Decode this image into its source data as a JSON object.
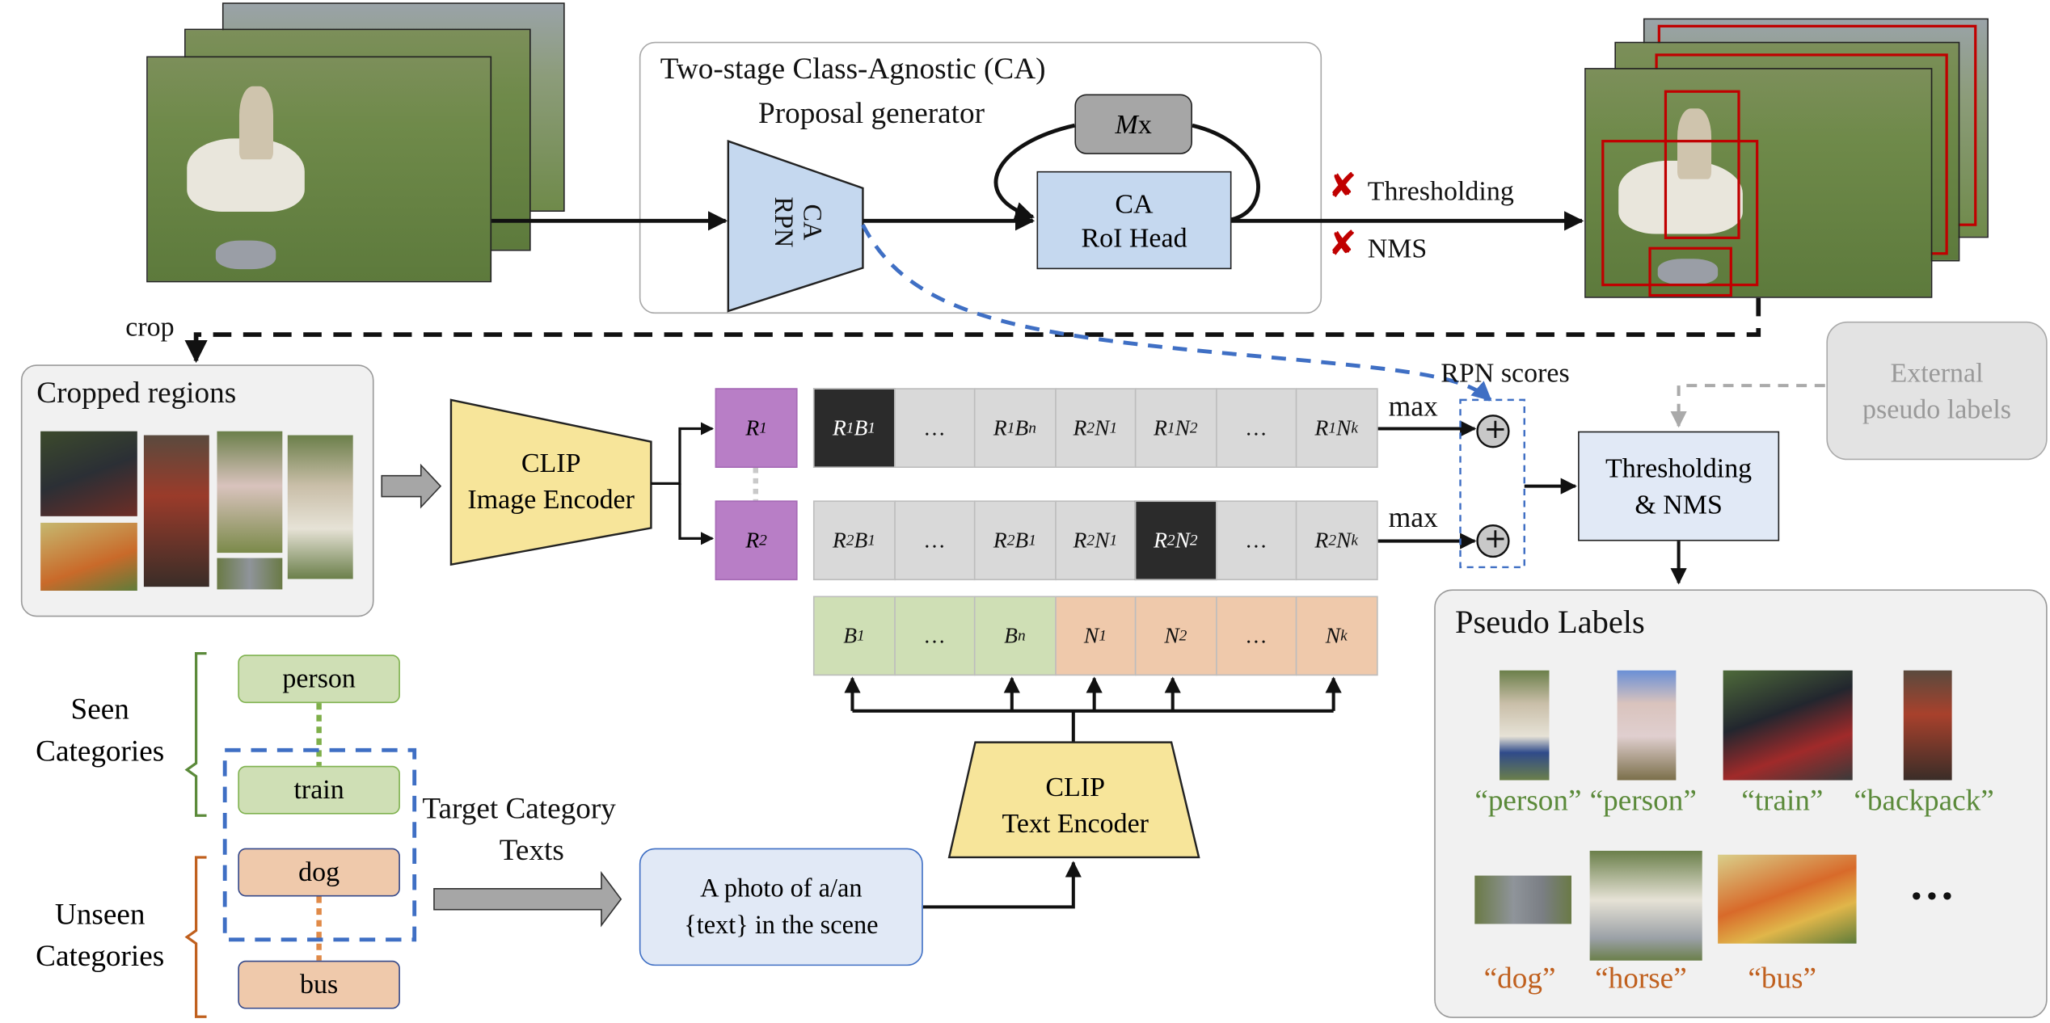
{
  "proposal_generator": {
    "title_line1": "Two-stage Class-Agnostic (CA)",
    "title_line2": "Proposal generator",
    "rpn_line1": "CA",
    "rpn_line2": "RPN",
    "roi_line1": "CA",
    "roi_line2": "RoI Head",
    "repeat_label_italic": "M",
    "repeat_label_suffix": "x"
  },
  "post_process": {
    "disabled_items": [
      {
        "label": "Thresholding",
        "icon": "x-mark-icon"
      },
      {
        "label": "NMS",
        "icon": "x-mark-icon"
      }
    ],
    "x_color": "#c00000"
  },
  "crop_label": "crop",
  "cropped_regions": {
    "title": "Cropped regions"
  },
  "clip_image_encoder": {
    "line1": "CLIP",
    "line2": "Image Encoder"
  },
  "region_features": [
    {
      "base": "R",
      "sub": "1"
    },
    {
      "base": "R",
      "sub": "2"
    }
  ],
  "similarity_rows": [
    {
      "cells": [
        {
          "a": "R",
          "as": "1",
          "b": "B",
          "bs": "1",
          "highlight": true
        },
        {
          "ellipsis": "…"
        },
        {
          "a": "R",
          "as": "1",
          "b": "B",
          "bs": "n"
        },
        {
          "a": "R",
          "as": "2",
          "b": "N",
          "bs": "1"
        },
        {
          "a": "R",
          "as": "1",
          "b": "N",
          "bs": "2"
        },
        {
          "ellipsis": "…"
        },
        {
          "a": "R",
          "as": "1",
          "b": "N",
          "bs": "k"
        }
      ],
      "max_label": "max"
    },
    {
      "cells": [
        {
          "a": "R",
          "as": "2",
          "b": "B",
          "bs": "1"
        },
        {
          "ellipsis": "…"
        },
        {
          "a": "R",
          "as": "2",
          "b": "B",
          "bs": "1"
        },
        {
          "a": "R",
          "as": "2",
          "b": "N",
          "bs": "1"
        },
        {
          "a": "R",
          "as": "2",
          "b": "N",
          "bs": "2",
          "highlight": true
        },
        {
          "ellipsis": "…"
        },
        {
          "a": "R",
          "as": "2",
          "b": "N",
          "bs": "k"
        }
      ],
      "max_label": "max"
    }
  ],
  "text_embeddings": [
    {
      "base": "B",
      "sub": "1",
      "group": "seen"
    },
    {
      "ellipsis": "…",
      "group": "seen"
    },
    {
      "base": "B",
      "sub": "n",
      "group": "seen"
    },
    {
      "base": "N",
      "sub": "1",
      "group": "unseen"
    },
    {
      "base": "N",
      "sub": "2",
      "group": "unseen"
    },
    {
      "ellipsis": "…",
      "group": "unseen"
    },
    {
      "base": "N",
      "sub": "k",
      "group": "unseen"
    }
  ],
  "rpn_scores_label": "RPN scores",
  "add_symbol": "+",
  "thresholding_nms": {
    "line1": "Thresholding",
    "line2": "& NMS"
  },
  "external_pseudo_labels": {
    "line1": "External",
    "line2": "pseudo labels"
  },
  "clip_text_encoder": {
    "line1": "CLIP",
    "line2": "Text Encoder"
  },
  "prompt_template": {
    "line1": "A photo of a/an",
    "line2": "{text} in the scene"
  },
  "target_category_texts": {
    "line1": "Target Category",
    "line2": "Texts"
  },
  "seen_categories": {
    "label_line1": "Seen",
    "label_line2": "Categories",
    "items": [
      "person",
      "train"
    ]
  },
  "unseen_categories": {
    "label_line1": "Unseen",
    "label_line2": "Categories",
    "items": [
      "dog",
      "bus"
    ]
  },
  "pseudo_labels": {
    "title": "Pseudo Labels",
    "row1": [
      {
        "label": "“person”",
        "type": "seen"
      },
      {
        "label": "“person”",
        "type": "seen"
      },
      {
        "label": "“train”",
        "type": "seen"
      },
      {
        "label": "“backpack”",
        "type": "seen"
      }
    ],
    "row2": [
      {
        "label": "“dog”",
        "type": "unseen"
      },
      {
        "label": "“horse”",
        "type": "unseen"
      },
      {
        "label": "“bus”",
        "type": "unseen"
      }
    ],
    "more": "•••"
  },
  "colors": {
    "seen_green": "#5b8a3a",
    "unseen_orange": "#c0601e",
    "blue_dashed": "#3f6fc4",
    "module_blue": "#c5d8ef",
    "clip_yellow": "#f7e59a",
    "region_purple": "#b87ec6"
  }
}
